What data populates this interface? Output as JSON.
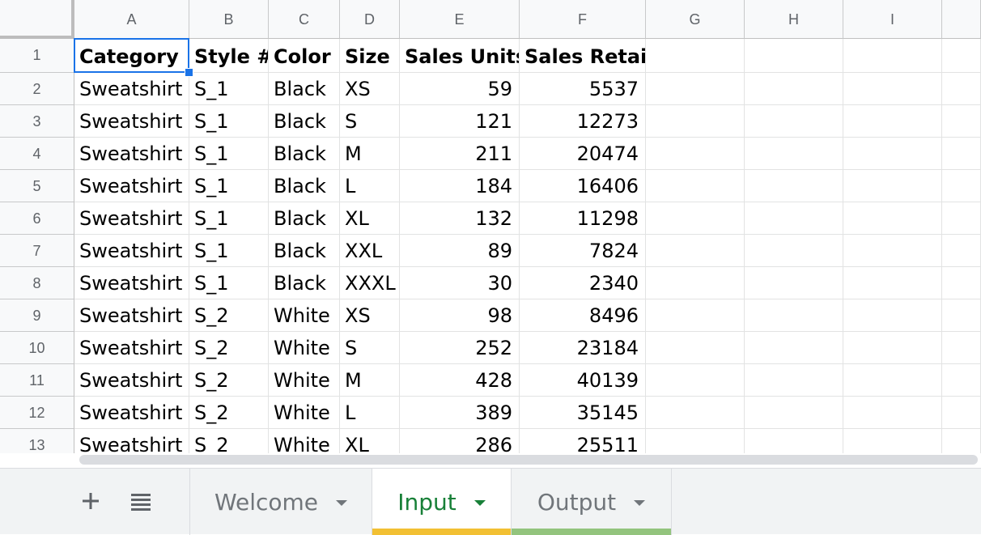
{
  "columns": [
    "A",
    "B",
    "C",
    "D",
    "E",
    "F",
    "G",
    "H",
    "I"
  ],
  "rows": [
    [
      "Category",
      "Style #",
      "Color",
      "Size",
      "Sales Units",
      "Sales Retail"
    ],
    [
      "Sweatshirt",
      "S_1",
      "Black",
      "XS",
      "59",
      "5537"
    ],
    [
      "Sweatshirt",
      "S_1",
      "Black",
      "S",
      "121",
      "12273"
    ],
    [
      "Sweatshirt",
      "S_1",
      "Black",
      "M",
      "211",
      "20474"
    ],
    [
      "Sweatshirt",
      "S_1",
      "Black",
      "L",
      "184",
      "16406"
    ],
    [
      "Sweatshirt",
      "S_1",
      "Black",
      "XL",
      "132",
      "11298"
    ],
    [
      "Sweatshirt",
      "S_1",
      "Black",
      "XXL",
      "89",
      "7824"
    ],
    [
      "Sweatshirt",
      "S_1",
      "Black",
      "XXXL",
      "30",
      "2340"
    ],
    [
      "Sweatshirt",
      "S_2",
      "White",
      "XS",
      "98",
      "8496"
    ],
    [
      "Sweatshirt",
      "S_2",
      "White",
      "S",
      "252",
      "23184"
    ],
    [
      "Sweatshirt",
      "S_2",
      "White",
      "M",
      "428",
      "40139"
    ],
    [
      "Sweatshirt",
      "S_2",
      "White",
      "L",
      "389",
      "35145"
    ],
    [
      "Sweatshirt",
      "S_2",
      "White",
      "XL",
      "286",
      "25511"
    ]
  ],
  "numeric_columns": [
    4,
    5
  ],
  "selected_cell": "A1",
  "sheet_tabs": [
    {
      "label": "Welcome",
      "active": false,
      "underline_color": ""
    },
    {
      "label": "Input",
      "active": true,
      "underline_color": "#f2c033"
    },
    {
      "label": "Output",
      "active": false,
      "underline_color": "#93c47d"
    }
  ],
  "icons": {
    "add_sheet": "plus-icon",
    "all_sheets": "list-icon"
  }
}
